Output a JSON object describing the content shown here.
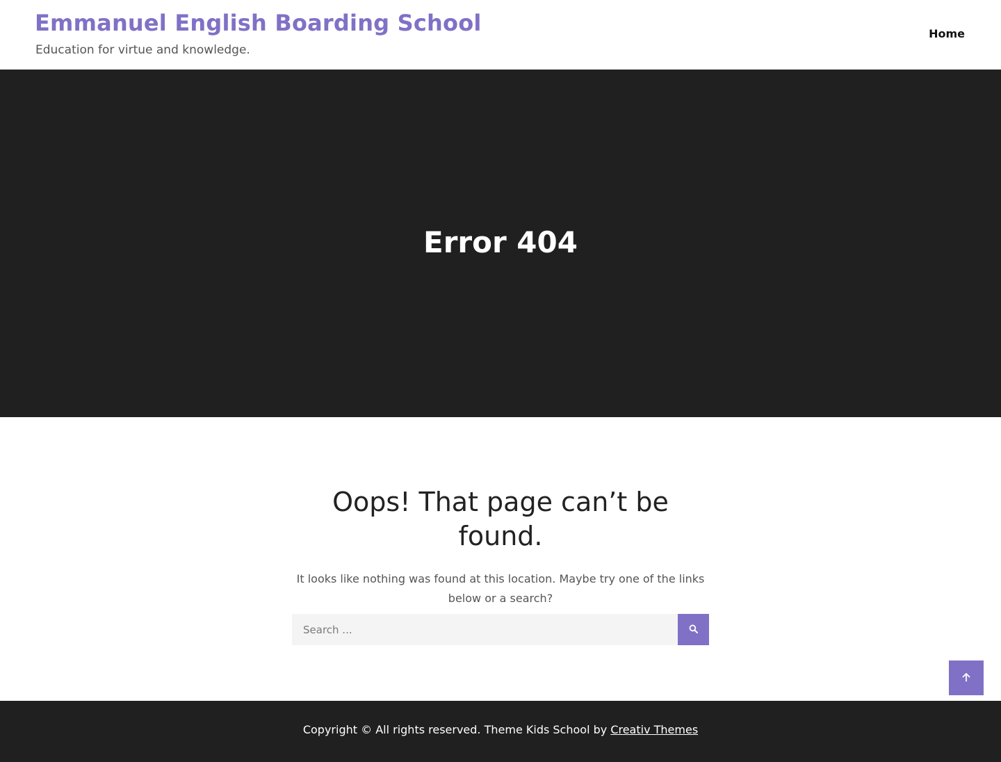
{
  "header": {
    "site_title": "Emmanuel English Boarding School",
    "tagline": "Education for virtue and knowledge.",
    "nav": {
      "home": "Home"
    }
  },
  "hero": {
    "title": "Error 404"
  },
  "main": {
    "heading": "Oops! That page can’t be found.",
    "message": "It looks like nothing was found at this location. Maybe try one of the links below or a search?",
    "search": {
      "placeholder": "Search ...",
      "value": "",
      "button_icon": "search-icon"
    }
  },
  "back_to_top": {
    "icon": "arrow-up-icon"
  },
  "footer": {
    "copyright_text": "Copyright © All rights reserved. Theme Kids School by ",
    "credit_link": "Creativ Themes"
  },
  "colors": {
    "accent": "#8071c6",
    "dark_band": "#202020",
    "input_bg": "#f4f4f4"
  }
}
